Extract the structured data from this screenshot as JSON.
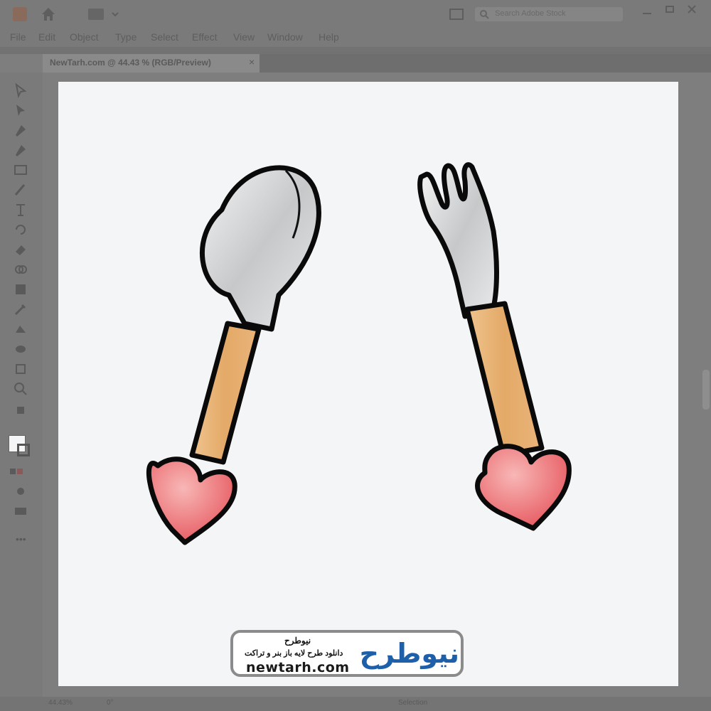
{
  "app": {
    "menu": [
      "File",
      "Edit",
      "Object",
      "Type",
      "Select",
      "Effect",
      "View",
      "Window",
      "Help"
    ],
    "search_placeholder": "Search Adobe Stock",
    "document_tab": "NewTarh.com @ 44.43 % (RGB/Preview)",
    "status": {
      "zoom": "44.43%",
      "rotation": "0°",
      "mode": "Selection"
    }
  },
  "artwork": {
    "items": [
      "spoon",
      "fork"
    ],
    "colors": {
      "handle": "#eab47a",
      "heart": "#ec6f74",
      "metal": "#c9cbcd",
      "outline": "#0a0a0a"
    }
  },
  "watermark": {
    "brand_fa": "نیوطرح",
    "name_fa": "نیوطرح",
    "tagline_fa": "دانلود طرح لایه باز بنر و تراکت",
    "url": "newtarh.com",
    "colors": {
      "blue": "#1d5fa8",
      "red": "#e0242a"
    }
  }
}
